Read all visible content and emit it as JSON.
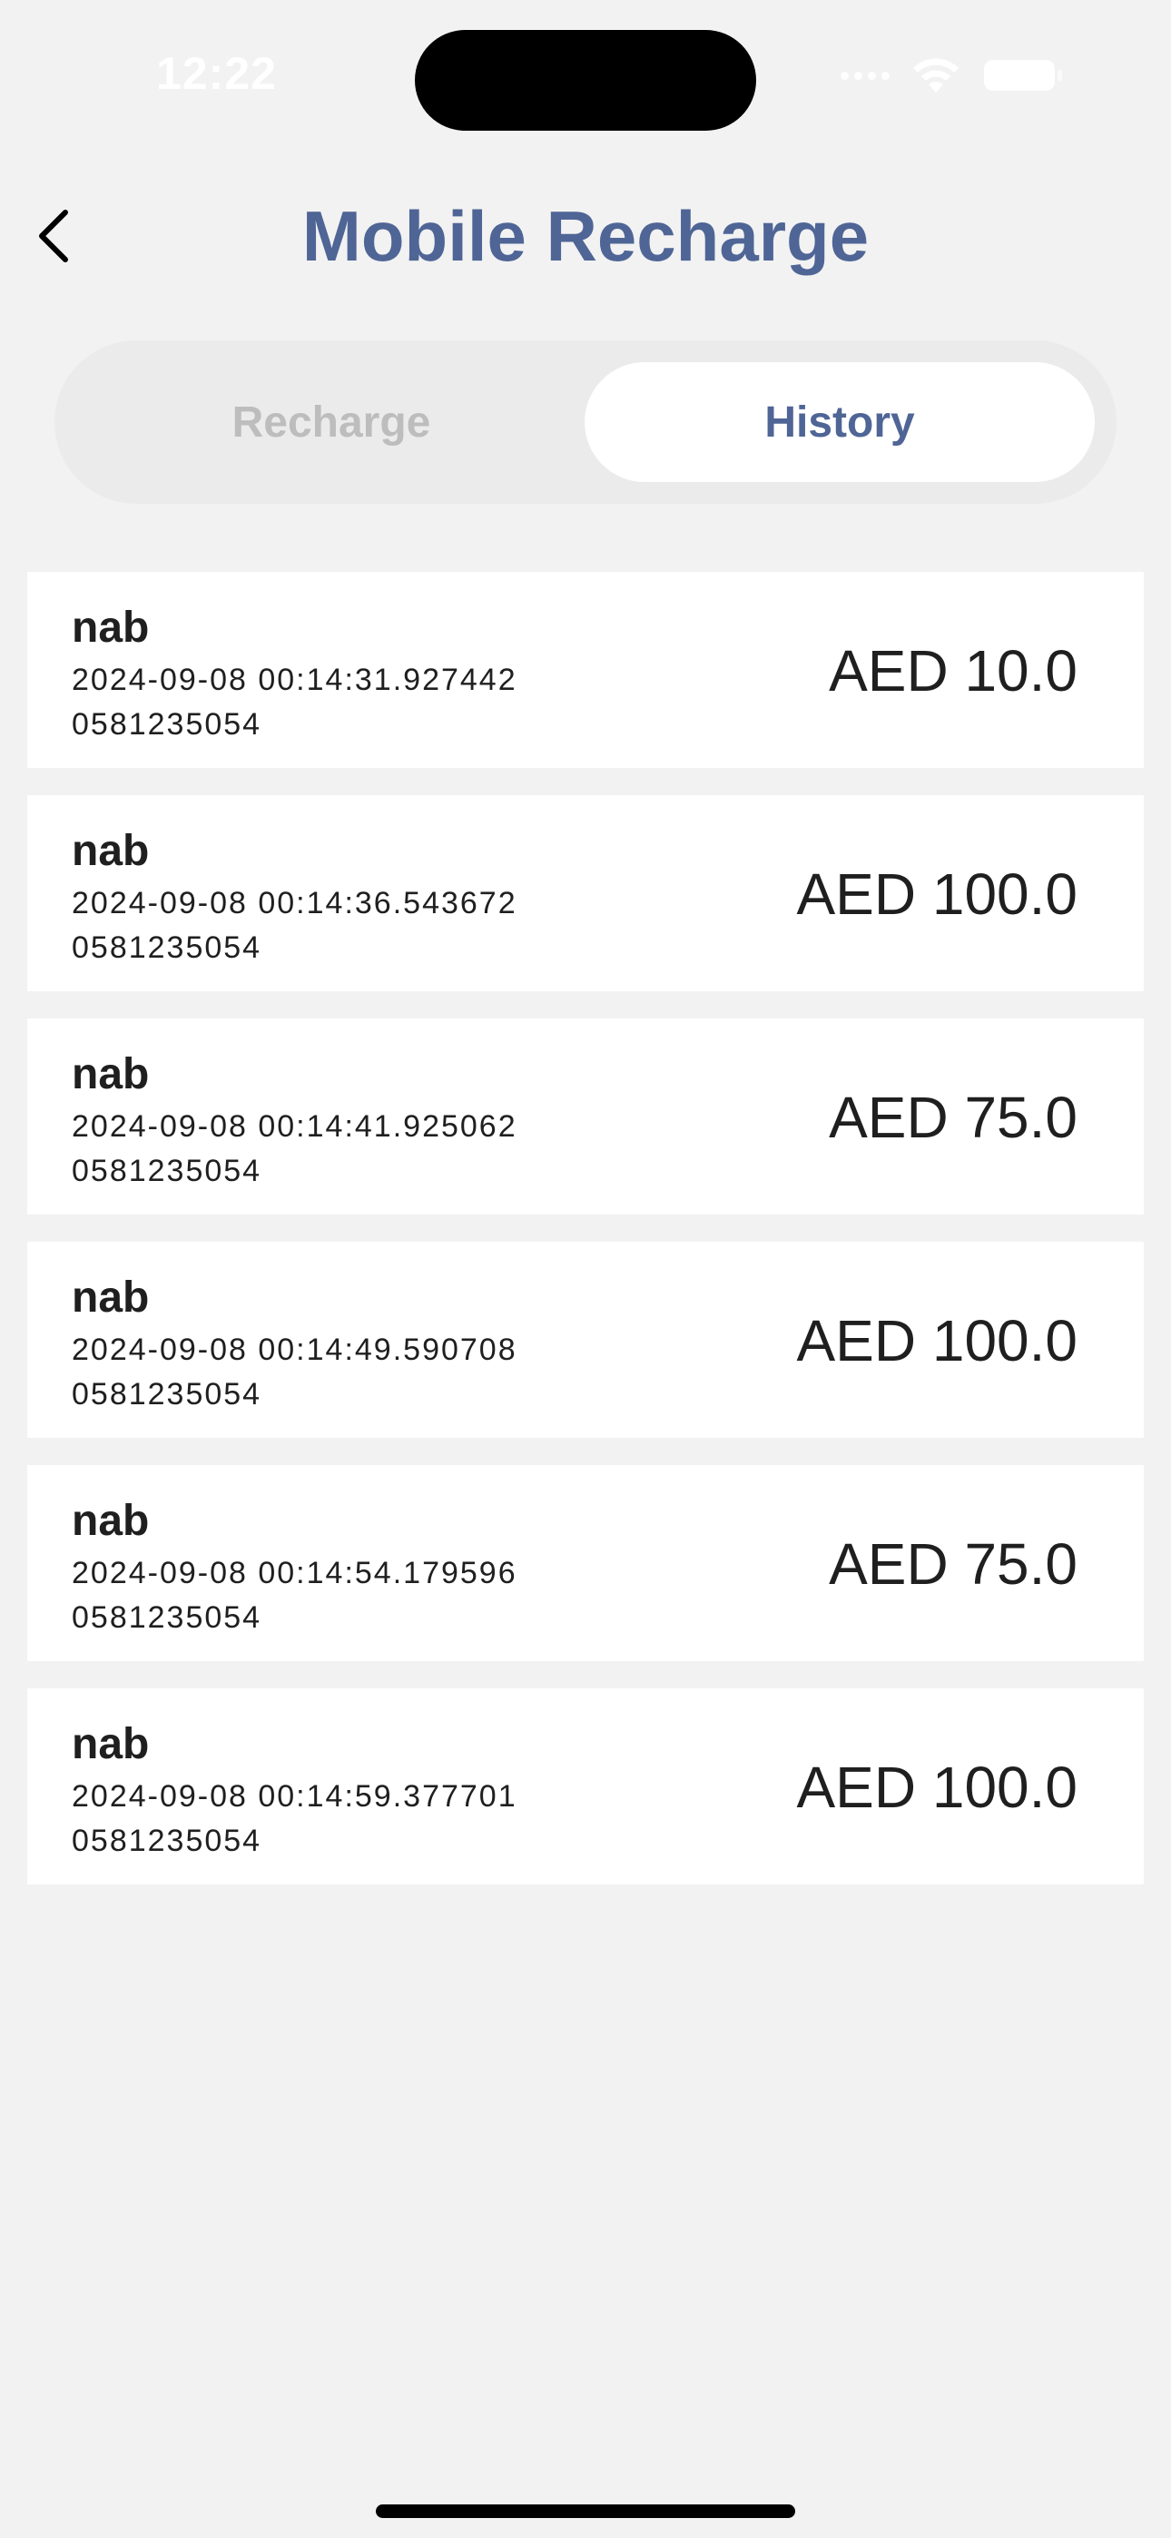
{
  "status_bar": {
    "time": "12:22"
  },
  "header": {
    "title": "Mobile Recharge",
    "back_icon": "chevron-left-icon"
  },
  "tabs": [
    {
      "label": "Recharge",
      "selected": false
    },
    {
      "label": "History",
      "selected": true
    }
  ],
  "history": [
    {
      "name": "nab",
      "date": "2024-09-08 00:14:31.927442",
      "phone": "0581235054",
      "amount": "AED 10.0"
    },
    {
      "name": "nab",
      "date": "2024-09-08 00:14:36.543672",
      "phone": "0581235054",
      "amount": "AED 100.0"
    },
    {
      "name": "nab",
      "date": "2024-09-08 00:14:41.925062",
      "phone": "0581235054",
      "amount": "AED 75.0"
    },
    {
      "name": "nab",
      "date": "2024-09-08 00:14:49.590708",
      "phone": "0581235054",
      "amount": "AED 100.0"
    },
    {
      "name": "nab",
      "date": "2024-09-08 00:14:54.179596",
      "phone": "0581235054",
      "amount": "AED 75.0"
    },
    {
      "name": "nab",
      "date": "2024-09-08 00:14:59.377701",
      "phone": "0581235054",
      "amount": "AED 100.0"
    }
  ],
  "colors": {
    "accent": "#4f6596",
    "background": "#f2f2f2",
    "card": "#ffffff",
    "inactive_tab_text": "#bdbdbd"
  }
}
